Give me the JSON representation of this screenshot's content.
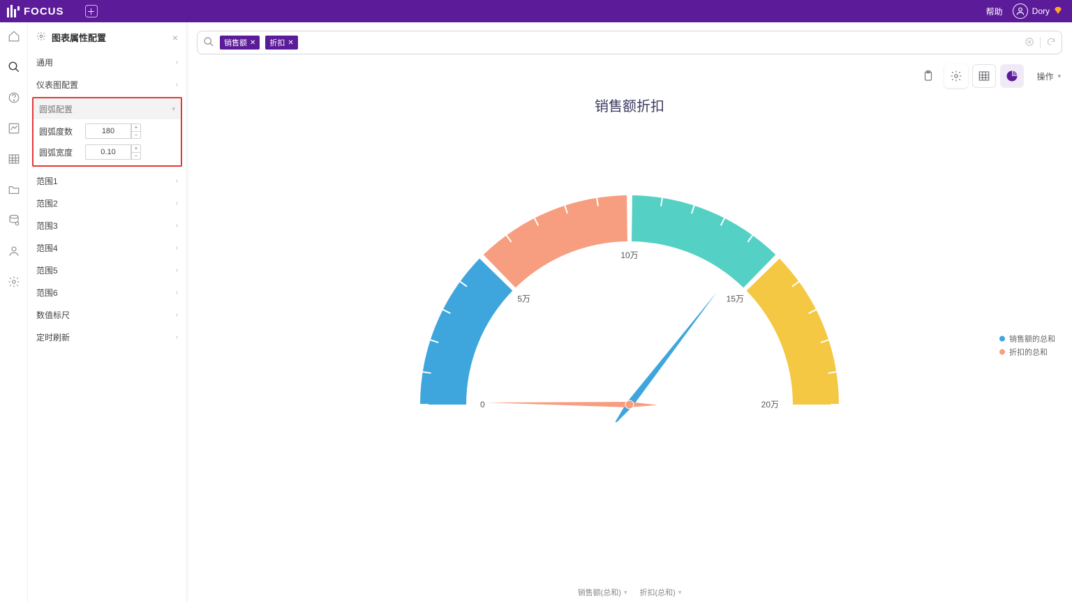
{
  "header": {
    "logo_text": "FOCUS",
    "help_label": "帮助",
    "user_name": "Dory"
  },
  "panel": {
    "title": "图表属性配置",
    "rows_top": [
      {
        "label": "通用"
      },
      {
        "label": "仪表图配置"
      }
    ],
    "arc_section": {
      "title": "圆弧配置",
      "fields": {
        "degree": {
          "label": "圆弧度数",
          "value": "180"
        },
        "width": {
          "label": "圆弧宽度",
          "value": "0.10"
        }
      }
    },
    "rows_bottom": [
      {
        "label": "范围1"
      },
      {
        "label": "范围2"
      },
      {
        "label": "范围3"
      },
      {
        "label": "范围4"
      },
      {
        "label": "范围5"
      },
      {
        "label": "范围6"
      },
      {
        "label": "数值标尺"
      },
      {
        "label": "定时刷新"
      }
    ]
  },
  "search": {
    "chips": [
      {
        "label": "销售额"
      },
      {
        "label": "折扣"
      }
    ]
  },
  "toolbar": {
    "ops_label": "操作"
  },
  "chart": {
    "title": "销售额折扣",
    "ticks": {
      "t0": "0",
      "t5": "5万",
      "t10": "10万",
      "t15": "15万",
      "t20": "20万"
    },
    "legend": {
      "s1": "销售额的总和",
      "s2": "折扣的总和"
    }
  },
  "footer": {
    "c1": "销售额(总和)",
    "c2": "折扣(总和)"
  },
  "chart_data": {
    "type": "gauge",
    "title": "销售额折扣",
    "min": 0,
    "max": 200000,
    "arc_degrees": 180,
    "arc_width_ratio": 0.1,
    "ticks_display": [
      "0",
      "5万",
      "10万",
      "15万",
      "20万"
    ],
    "ticks_values": [
      0,
      50000,
      100000,
      150000,
      200000
    ],
    "segments": [
      {
        "from": 0,
        "to": 50000,
        "color": "#3ea6dd"
      },
      {
        "from": 50000,
        "to": 100000,
        "color": "#f79e80"
      },
      {
        "from": 100000,
        "to": 150000,
        "color": "#55d0c4"
      },
      {
        "from": 150000,
        "to": 200000,
        "color": "#f4c843"
      }
    ],
    "pointers": [
      {
        "name": "销售额的总和",
        "value": 142000,
        "color": "#3ea6dd"
      },
      {
        "name": "折扣的总和",
        "value": 900,
        "color": "#f79e80"
      }
    ]
  }
}
